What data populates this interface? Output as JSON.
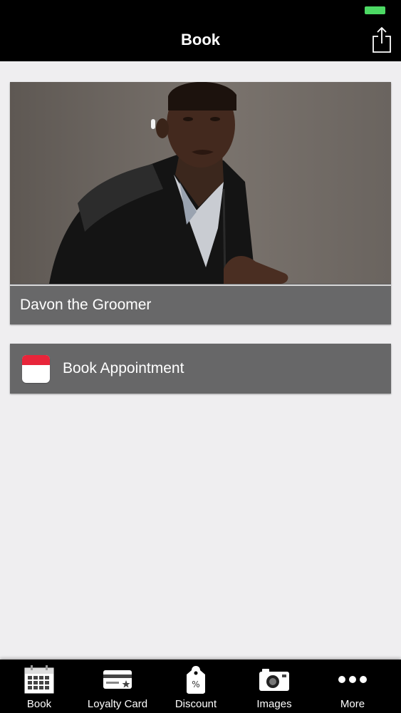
{
  "navbar": {
    "title": "Book",
    "share_icon": "share-icon"
  },
  "profile": {
    "name": "Davon the Groomer"
  },
  "book_button": {
    "label": "Book Appointment",
    "icon": "calendar-icon",
    "accent": "#e8253a"
  },
  "tabbar": {
    "tabs": [
      {
        "label": "Book",
        "icon": "calendar-grid-icon"
      },
      {
        "label": "Loyalty Card",
        "icon": "loyalty-card-icon"
      },
      {
        "label": "Discount",
        "icon": "discount-tag-icon"
      },
      {
        "label": "Images",
        "icon": "camera-icon"
      },
      {
        "label": "More",
        "icon": "more-dots-icon"
      }
    ]
  },
  "colors": {
    "battery": "#4cd964",
    "bar_background": "#000000",
    "card_background": "#676768"
  }
}
